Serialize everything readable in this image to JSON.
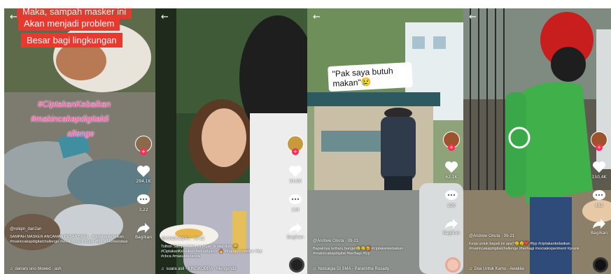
{
  "panels": [
    {
      "caption_lines": [
        "Maka, sampah masker ini",
        "Akan menjadi problem",
        "Besar bagi lingkungan"
      ],
      "hashtag_overlay": [
        "#CiptakanKebaikan",
        "#makincakapdigitaldi",
        "allenge"
      ],
      "like_count": "294,1K",
      "comment_count": "3,22",
      "share_count": "Bagikan",
      "username": "@reliqin_dari2an",
      "description": "SAMPAH MASKER ANCAMAN BESAR BAGI... #ciptakankebaikan #makincakapdigitalchallenge #environment #care #fyp #rekomendasi",
      "music": "danaru uno blowed · ash"
    },
    {
      "like_count": "34,9K",
      "comment_count": "134",
      "share_count": "Bagikan",
      "username": "@KINGKOBRA · 09-22",
      "description": "Tolhon Sampe hates ya jngan di skip dulu 😂 #CiptakanKebaikan #squadgacor 🔥 #kejugetyoldslice #fyp #cbca #masukberanda",
      "music": "suara asli - KINGKOBRA · Mengendu"
    },
    {
      "caption": "\"Pak saya butuh makan\"😢",
      "like_count": "62,1K",
      "comment_count": "290",
      "share_count": "Bagikan",
      "username": "@Andrew Onuta · 09-21",
      "description": "Bapaknya terharu banget😢😢🥰 #ciptakankebaikan #makincakapdigital #berbagi #fyp",
      "music": "Nostalgia Di SMA - Paramitha Rusady"
    },
    {
      "like_count": "150,4K",
      "comment_count": "483",
      "share_count": "Bagikan",
      "username": "@Andrew Onuta · 09-21",
      "description": "Kerja untuk bapak ini apa?😢😢❤️ #fyp #ciptakankebaikan #makincakapdigitalchallenge #berbagi #socialexperiment #prank",
      "music": "Doa Untuk Kamu - Awakila"
    }
  ]
}
